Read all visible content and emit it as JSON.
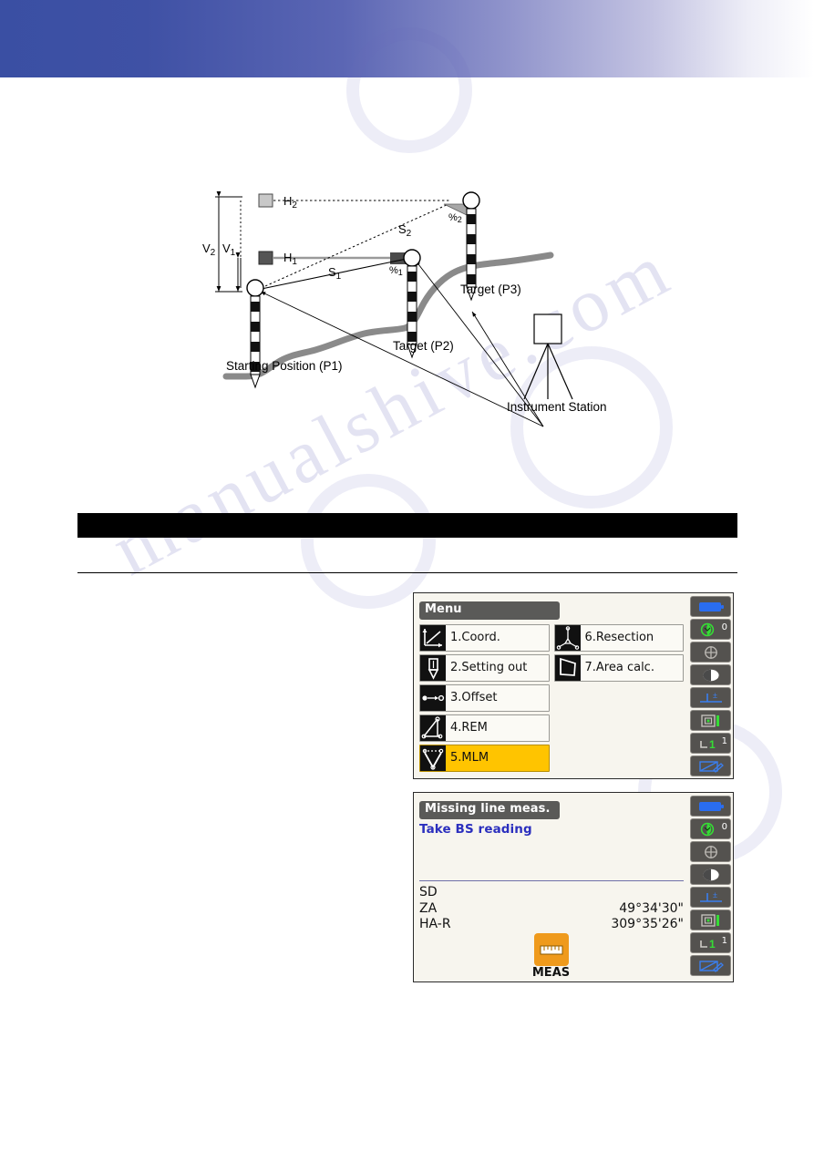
{
  "page": {
    "header_band": {
      "name": "decorative-gradient-band",
      "color_left": "#3a4fa3",
      "color_right": "#ffffff"
    },
    "black_bar": {
      "text": "",
      "color": "#000000"
    },
    "watermark_text": "manualshive.com"
  },
  "figure": {
    "name": "missing-line-measurement-diagram",
    "labels": {
      "h2": "H",
      "h2_sub": "2",
      "h1": "H",
      "h1_sub": "1",
      "s2": "S",
      "s2_sub": "2",
      "s1": "S",
      "s1_sub": "1",
      "v2": "V",
      "v2_sub": "2",
      "v1": "V",
      "v1_sub": "1",
      "pct2": "%",
      "pct2_sub": "2",
      "pct1": "%",
      "pct1_sub": "1",
      "target_p3": "Target (P3)",
      "target_p2": "Target (P2)",
      "starting_position": "Starting Position (P1)",
      "instrument_station": "Instrument Station"
    }
  },
  "screen_menu": {
    "title": "Menu",
    "selected_index": 4,
    "items_left": [
      {
        "label": "1.Coord.",
        "icon": "coordinate-axes-icon",
        "selected": false
      },
      {
        "label": "2.Setting out",
        "icon": "prism-pole-icon",
        "selected": false
      },
      {
        "label": "3.Offset",
        "icon": "offset-points-icon",
        "selected": false
      },
      {
        "label": "4.REM",
        "icon": "remote-elevation-icon",
        "selected": false
      },
      {
        "label": "5.MLM",
        "icon": "missing-line-icon",
        "selected": true
      }
    ],
    "items_right": [
      {
        "label": "6.Resection",
        "icon": "resection-icon",
        "selected": false
      },
      {
        "label": "7.Area calc.",
        "icon": "area-polygon-icon",
        "selected": false
      }
    ],
    "status_icons": [
      {
        "name": "battery-icon",
        "value": ""
      },
      {
        "name": "target-type-icon",
        "value": "0"
      },
      {
        "name": "crosshair-icon",
        "value": ""
      },
      {
        "name": "contrast-icon",
        "value": ""
      },
      {
        "name": "tilt-correction-icon",
        "value": ""
      },
      {
        "name": "laser-pointer-icon",
        "value": ""
      },
      {
        "name": "input-mode-icon",
        "value": "1"
      },
      {
        "name": "edit-mode-icon",
        "value": ""
      }
    ]
  },
  "screen_mlm": {
    "title": "Missing line meas.",
    "note": "Take BS reading",
    "rows": [
      {
        "label": "SD",
        "value": ""
      },
      {
        "label": "ZA",
        "value": "49°34'30\""
      },
      {
        "label": "HA-R",
        "value": "309°35'26\""
      }
    ],
    "meas_button": {
      "label": "MEAS",
      "icon": "ruler-icon",
      "color": "#ef9a1c"
    },
    "status_icons": [
      {
        "name": "battery-icon",
        "value": ""
      },
      {
        "name": "target-type-icon",
        "value": "0"
      },
      {
        "name": "crosshair-icon",
        "value": ""
      },
      {
        "name": "contrast-icon",
        "value": ""
      },
      {
        "name": "tilt-correction-icon",
        "value": ""
      },
      {
        "name": "laser-pointer-icon",
        "value": ""
      },
      {
        "name": "input-mode-icon",
        "value": "1"
      },
      {
        "name": "edit-mode-icon",
        "value": ""
      }
    ]
  }
}
